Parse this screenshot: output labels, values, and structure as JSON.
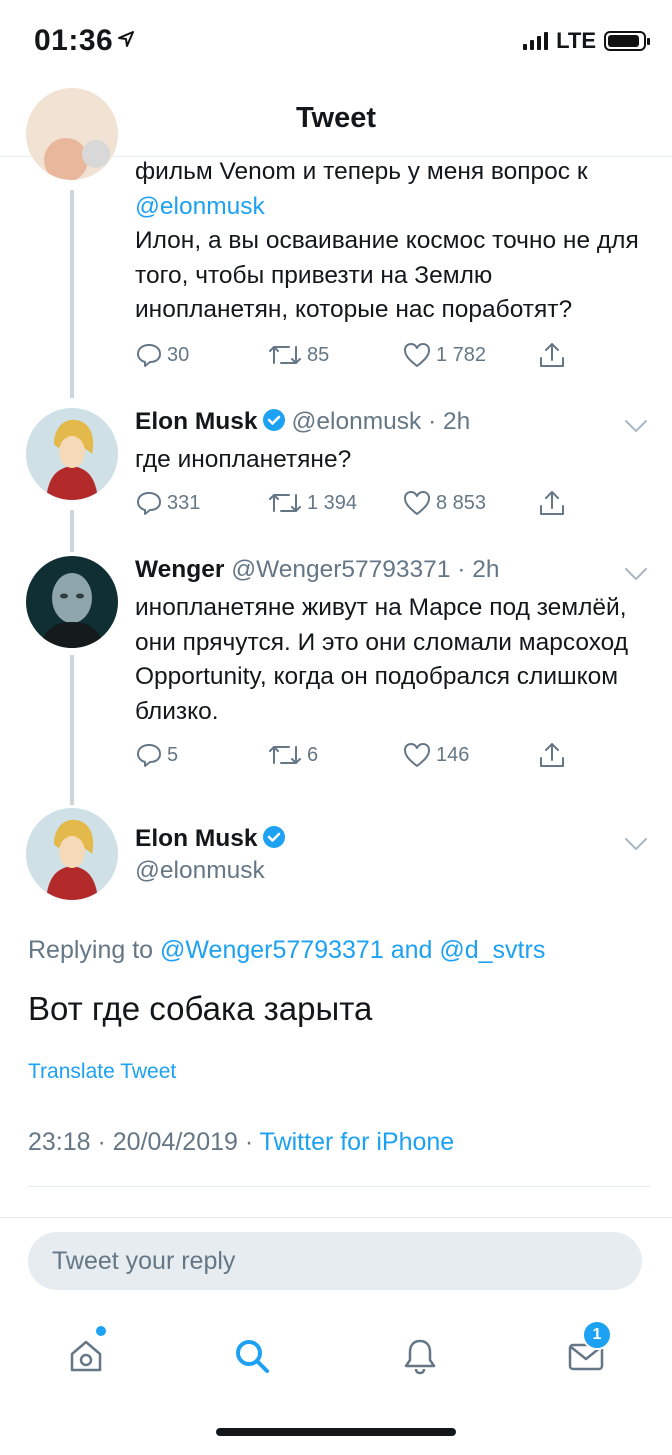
{
  "status_bar": {
    "time": "01:36",
    "network": "LTE"
  },
  "header": {
    "title": "Tweet"
  },
  "tweets": [
    {
      "text_line1": "фильм Venom и теперь у меня вопрос к",
      "mention": "@elonmusk",
      "text_rest": "Илон, а вы осваивание космос точно не для того, чтобы привезти на Землю инопланетян, которые нас поработят?",
      "replies": "30",
      "retweets": "85",
      "likes": "1 782"
    },
    {
      "name": "Elon Musk",
      "handle": "@elonmusk",
      "time": "· 2h",
      "text": "где инопланетяне?",
      "replies": "331",
      "retweets": "1 394",
      "likes": "8 853"
    },
    {
      "name": "Wenger",
      "handle": "@Wenger57793371",
      "time": "· 2h",
      "text": "инопланетяне живут на Марсе под землёй, они прячутся. И это они сломали марсоход Opportunity, когда он подобрался слишком близко.",
      "replies": "5",
      "retweets": "6",
      "likes": "146"
    }
  ],
  "focus": {
    "name": "Elon Musk",
    "handle": "@elonmusk",
    "replying_label": "Replying to",
    "replying_user1": "@Wenger57793371",
    "replying_and": "and",
    "replying_user2": "@d_svtrs",
    "text": "Вот где собака зарыта",
    "translate": "Translate Tweet",
    "timestamp": "23:18 · 20/04/2019 ·",
    "source": "Twitter for iPhone"
  },
  "reply_box": {
    "placeholder": "Tweet your reply"
  },
  "tabbar": {
    "messages_badge": "1"
  },
  "colors": {
    "accent": "#1da1f2",
    "muted": "#657786",
    "text": "#14171a"
  }
}
